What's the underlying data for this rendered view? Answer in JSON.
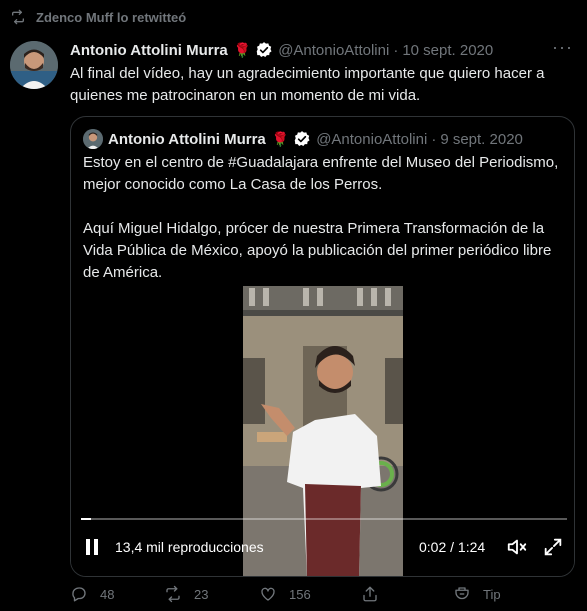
{
  "retweet": {
    "text": "Zdenco Muff lo retwitteó",
    "icon": "retweet-icon"
  },
  "tweet": {
    "author_name": "Antonio Attolini Murra",
    "author_emoji": "🌹",
    "author_handle": "@AntonioAttolini",
    "separator": "·",
    "date": "10 sept. 2020",
    "more": "···",
    "text": "Al final del vídeo, hay un agradecimiento importante que quiero hacer a quienes me patrocinaron en un momento de mi vida."
  },
  "quote": {
    "author_name": "Antonio Attolini Murra",
    "author_emoji": "🌹",
    "author_handle": "@AntonioAttolini",
    "separator": "·",
    "date": "9 sept. 2020",
    "paragraph1": "Estoy en el centro de #Guadalajara enfrente del Museo del Periodismo, mejor conocido como La Casa de los Perros.",
    "paragraph2": "Aquí Miguel Hidalgo, prócer de nuestra Primera Transformación de la Vida Pública de México, apoyó la publicación del primer periódico libre de América."
  },
  "video": {
    "views": "13,4 mil reproducciones",
    "time": "0:02 / 1:24",
    "progress": 0.02
  },
  "actions": {
    "replies": "48",
    "retweets": "23",
    "likes": "156",
    "tip": "Tip"
  },
  "colors": {
    "background": "#000000",
    "text": "#e7e9ea",
    "muted": "#71767b",
    "border": "#2f3336"
  }
}
